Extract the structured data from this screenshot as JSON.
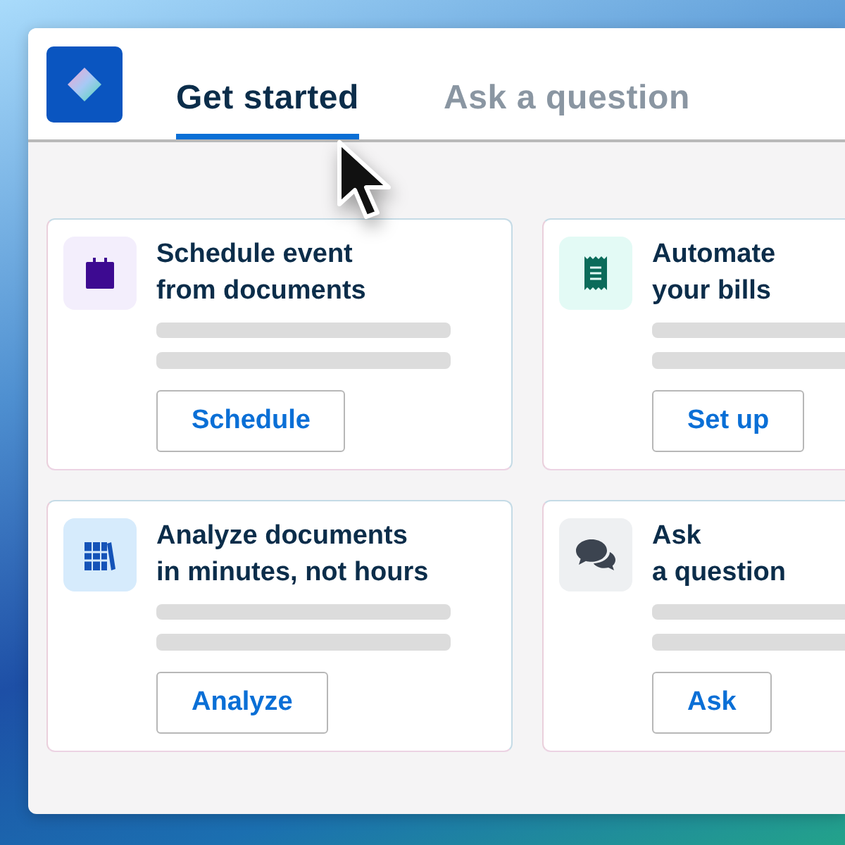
{
  "tabs": [
    {
      "label": "Get started",
      "selected": true
    },
    {
      "label": "Ask a question",
      "selected": false
    }
  ],
  "cards": [
    {
      "kind": "calendar",
      "title": [
        "Schedule event",
        "from documents"
      ],
      "button": "Schedule"
    },
    {
      "kind": "receipt",
      "title": [
        "Automate",
        "your bills"
      ],
      "button": "Set up"
    },
    {
      "kind": "books",
      "title": [
        "Analyze documents",
        "in minutes, not hours"
      ],
      "button": "Analyze"
    },
    {
      "kind": "chat",
      "title": [
        "Ask",
        "a question"
      ],
      "button": "Ask"
    }
  ]
}
